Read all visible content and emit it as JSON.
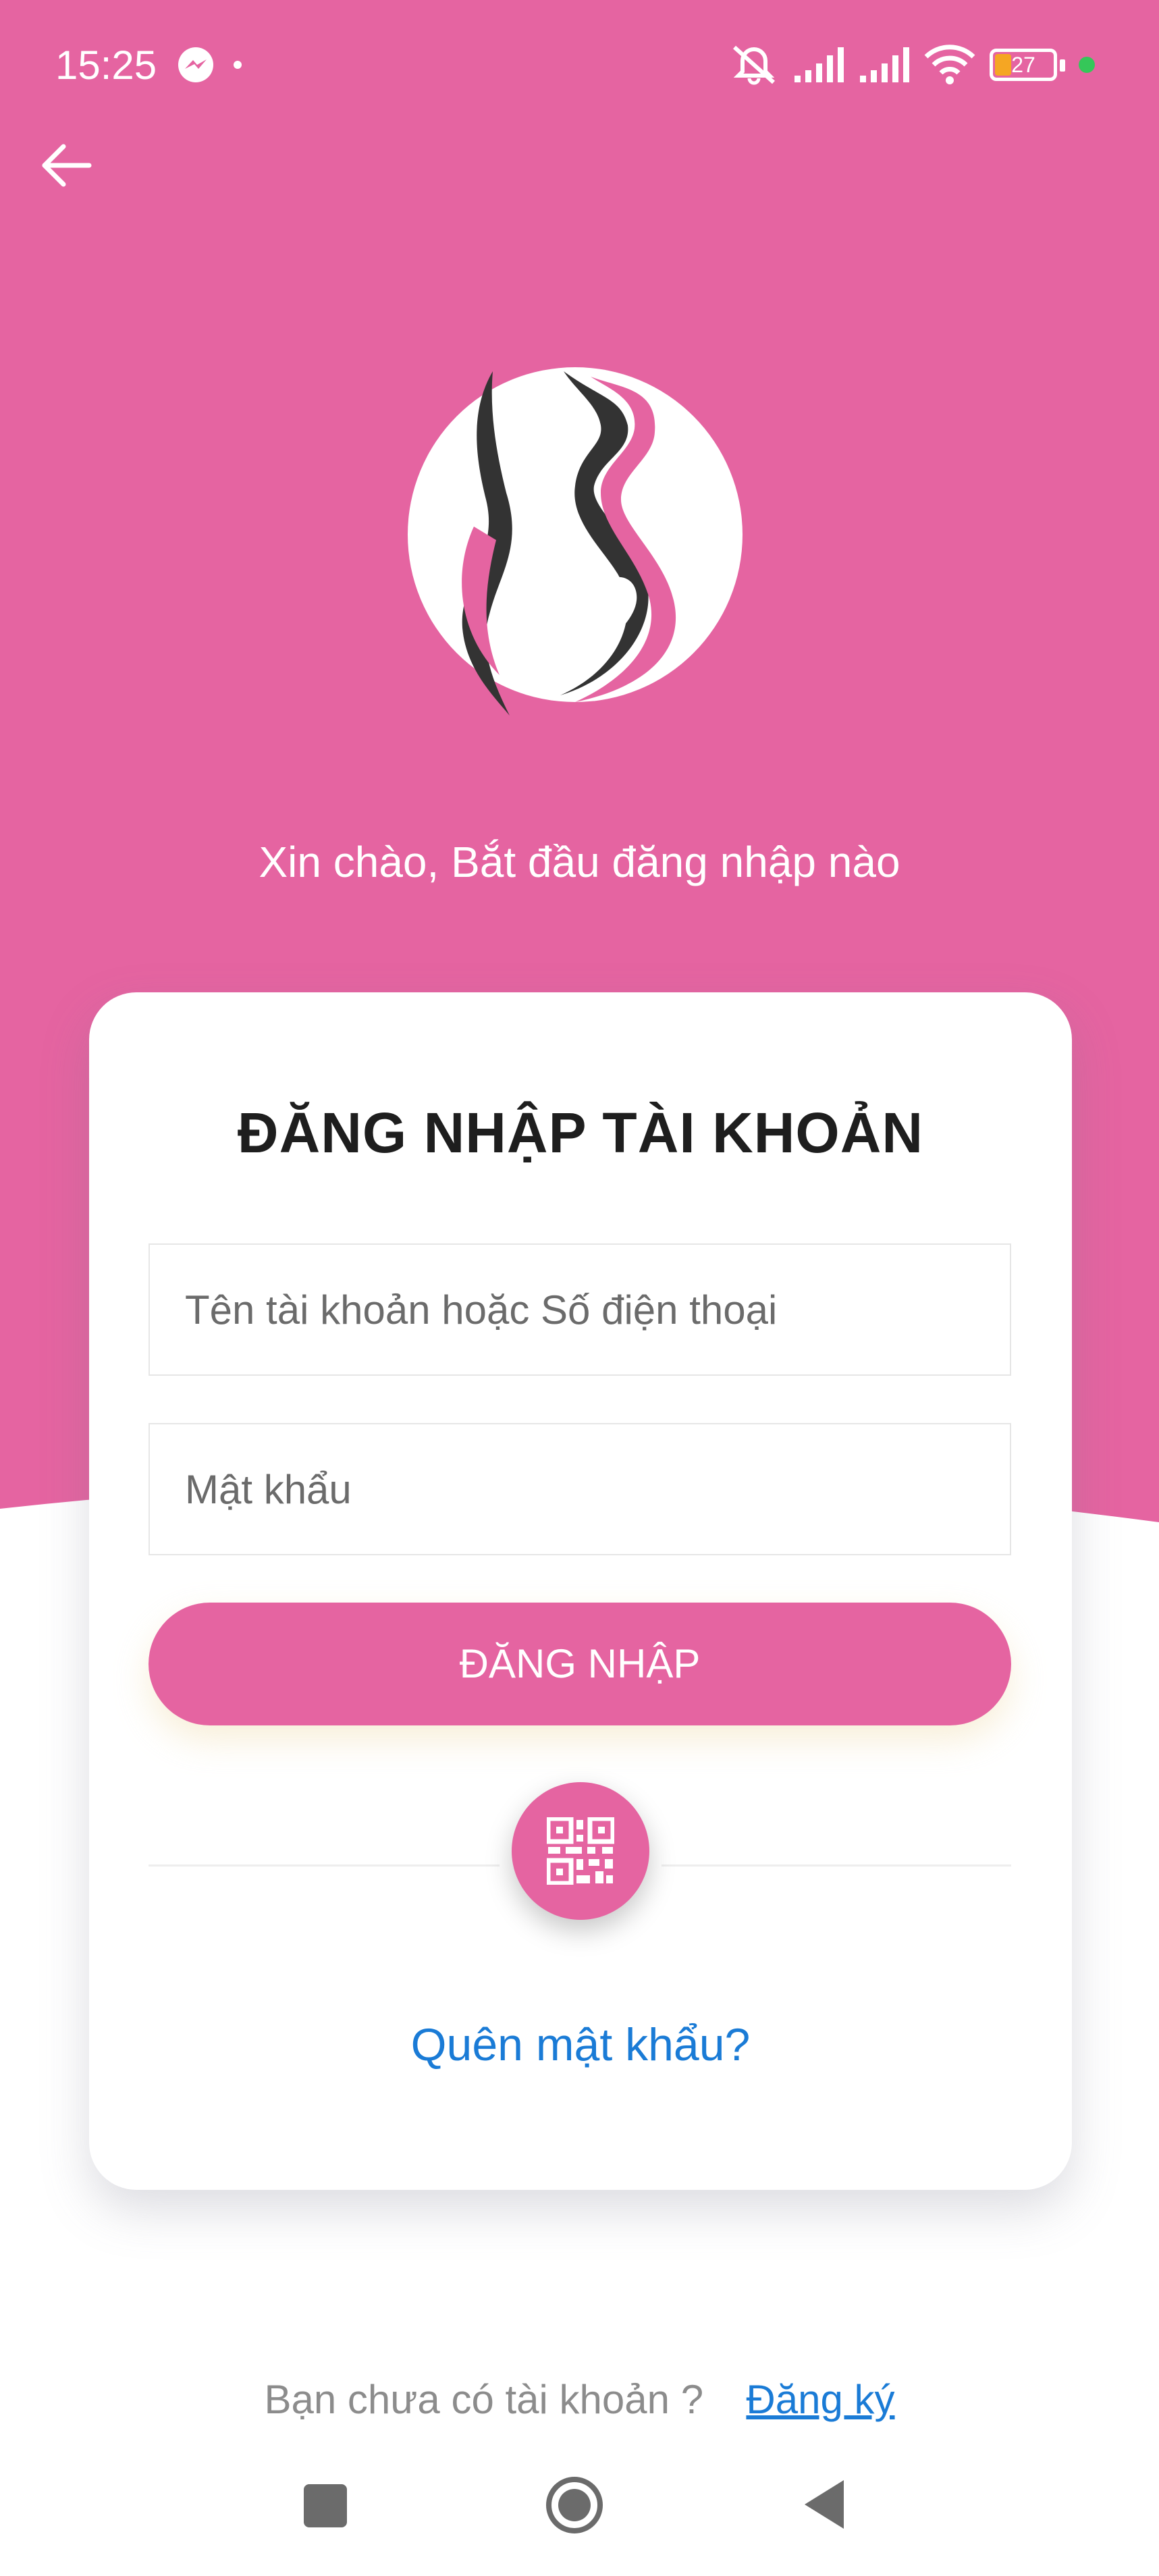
{
  "status_bar": {
    "time": "15:25",
    "icons": [
      "messenger-icon",
      "dot-icon",
      "mute-icon",
      "signal-icon",
      "signal-icon",
      "wifi-icon",
      "battery-icon"
    ],
    "battery_level": "27"
  },
  "header": {
    "greeting": "Xin chào, Bắt đầu đăng nhập nào"
  },
  "login_card": {
    "title": "ĐĂNG NHẬP TÀI KHOẢN",
    "username_placeholder": "Tên tài khoản hoặc Số điện thoại",
    "username_value": "",
    "password_placeholder": "Mật khẩu",
    "password_value": "",
    "login_button": "ĐĂNG NHẬP",
    "forgot_password": "Quên mật khẩu?"
  },
  "footer": {
    "no_account_text": "Bạn chưa có tài khoản ?",
    "register_link": "Đăng ký"
  },
  "colors": {
    "brand_pink": "#e564a1",
    "link_blue": "#1a7bd6",
    "title_text": "#1e1e1e"
  }
}
